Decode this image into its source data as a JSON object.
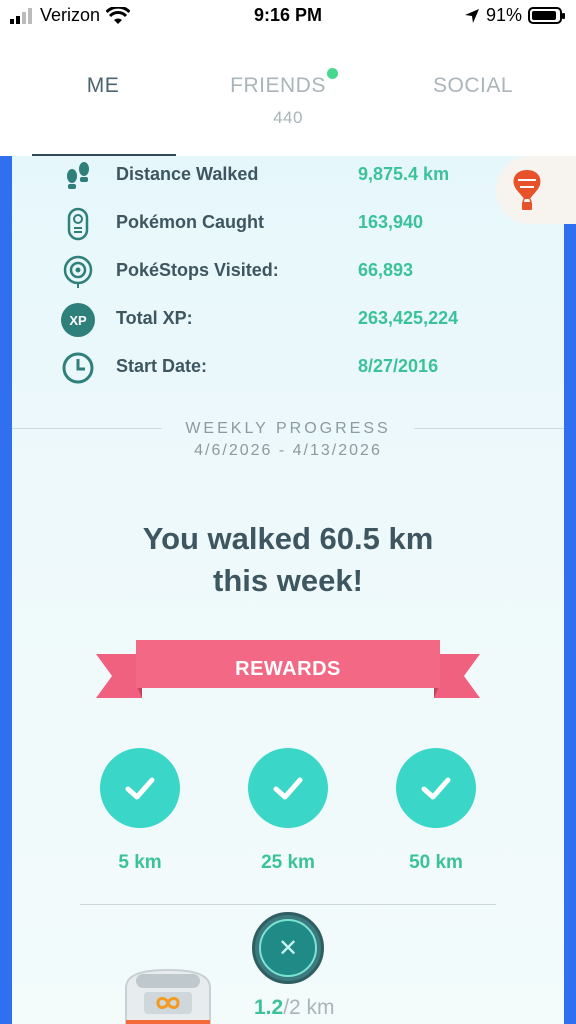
{
  "status_bar": {
    "carrier": "Verizon",
    "time": "9:16 PM",
    "battery_percent": "91%",
    "battery_level": 0.91
  },
  "tabs": {
    "me": "ME",
    "friends": "FRIENDS",
    "friends_count": "440",
    "social": "SOCIAL"
  },
  "stats": [
    {
      "label": "Distance Walked",
      "value": "9,875.4 km",
      "icon": "footprints-icon"
    },
    {
      "label": "Pokémon Caught",
      "value": "163,940",
      "icon": "pokedex-icon"
    },
    {
      "label": "PokéStops Visited:",
      "value": "66,893",
      "icon": "pokestop-icon"
    },
    {
      "label": "Total XP:",
      "value": "263,425,224",
      "icon": "xp-icon",
      "icon_text": "XP"
    },
    {
      "label": "Start Date:",
      "value": "8/27/2016",
      "icon": "clock-icon"
    }
  ],
  "weekly": {
    "title": "WEEKLY PROGRESS",
    "range": "4/6/2026 - 4/13/2026",
    "message_line1": "You walked 60.5 km",
    "message_line2": "this week!"
  },
  "rewards": {
    "title": "REWARDS",
    "milestones": [
      "5 km",
      "25 km",
      "50 km"
    ]
  },
  "egg": {
    "current": "1.2",
    "separator": "/",
    "total": "2 km",
    "close_symbol": "✕"
  },
  "colors": {
    "accent_green": "#3cc29a",
    "check_teal": "#3ad7c8",
    "ribbon_pink": "#f0607f",
    "edge_blue": "#2f6ff0"
  }
}
